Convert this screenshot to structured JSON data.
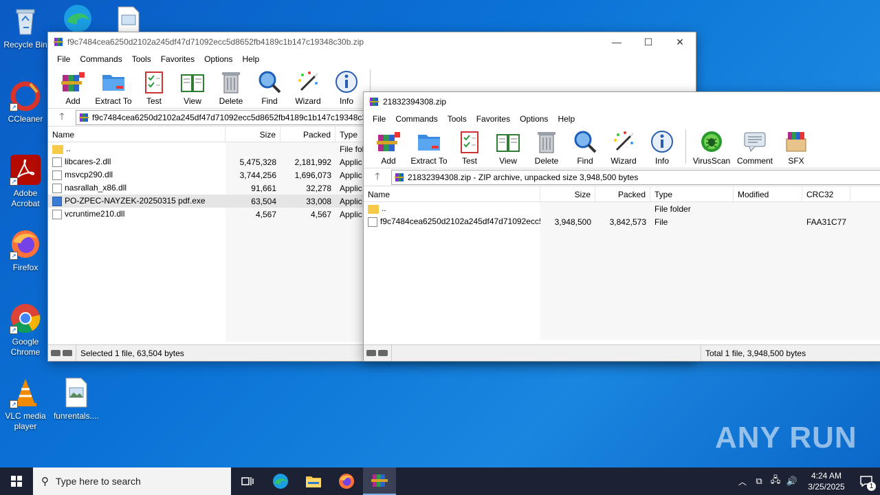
{
  "desktop": {
    "icons": [
      {
        "label": "Recycle Bin"
      },
      {
        "label": "CCleaner"
      },
      {
        "label": "Adobe Acrobat"
      },
      {
        "label": "Firefox"
      },
      {
        "label": "Google Chrome"
      },
      {
        "label": "VLC media player"
      },
      {
        "label": "funrentals...."
      }
    ]
  },
  "win1": {
    "title": "f9c7484cea6250d2102a245df47d71092ecc5d8652fb4189c1b147c19348c30b.zip",
    "menu": [
      "File",
      "Commands",
      "Tools",
      "Favorites",
      "Options",
      "Help"
    ],
    "toolbar": [
      "Add",
      "Extract To",
      "Test",
      "View",
      "Delete",
      "Find",
      "Wizard",
      "Info"
    ],
    "address": "f9c7484cea6250d2102a245df47d71092ecc5d8652fb4189c1b147c19348c30",
    "columns": [
      "Name",
      "Size",
      "Packed",
      "Type"
    ],
    "rows": [
      {
        "name": "..",
        "size": "",
        "packed": "",
        "type": "File fol"
      },
      {
        "name": "libcares-2.dll",
        "size": "5,475,328",
        "packed": "2,181,992",
        "type": "Applic"
      },
      {
        "name": "msvcp290.dll",
        "size": "3,744,256",
        "packed": "1,696,073",
        "type": "Applic"
      },
      {
        "name": "nasrallah_x86.dll",
        "size": "91,661",
        "packed": "32,278",
        "type": "Applic"
      },
      {
        "name": "PO-ZPEC-NAYZEK-20250315 pdf.exe",
        "size": "63,504",
        "packed": "33,008",
        "type": "Applic"
      },
      {
        "name": "vcruntime210.dll",
        "size": "4,567",
        "packed": "4,567",
        "type": "Applic"
      }
    ],
    "status": "Selected 1 file, 63,504 bytes"
  },
  "win2": {
    "title": "21832394308.zip",
    "menu": [
      "File",
      "Commands",
      "Tools",
      "Favorites",
      "Options",
      "Help"
    ],
    "toolbar": [
      "Add",
      "Extract To",
      "Test",
      "View",
      "Delete",
      "Find",
      "Wizard",
      "Info",
      "VirusScan",
      "Comment",
      "SFX"
    ],
    "address": "21832394308.zip - ZIP archive, unpacked size 3,948,500 bytes",
    "columns": [
      "Name",
      "Size",
      "Packed",
      "Type",
      "Modified",
      "CRC32"
    ],
    "rows": [
      {
        "name": "..",
        "size": "",
        "packed": "",
        "type": "File folder",
        "modified": "",
        "crc": ""
      },
      {
        "name": "f9c7484cea6250d2102a245df47d71092ecc5...",
        "size": "3,948,500",
        "packed": "3,842,573",
        "type": "File",
        "modified": "",
        "crc": "FAA31C77"
      }
    ],
    "status": "Total 1 file, 3,948,500 bytes"
  },
  "taskbar": {
    "search_placeholder": "Type here to search",
    "time": "4:24 AM",
    "date": "3/25/2025",
    "notification_count": "1"
  },
  "watermark": "ANY RUN"
}
